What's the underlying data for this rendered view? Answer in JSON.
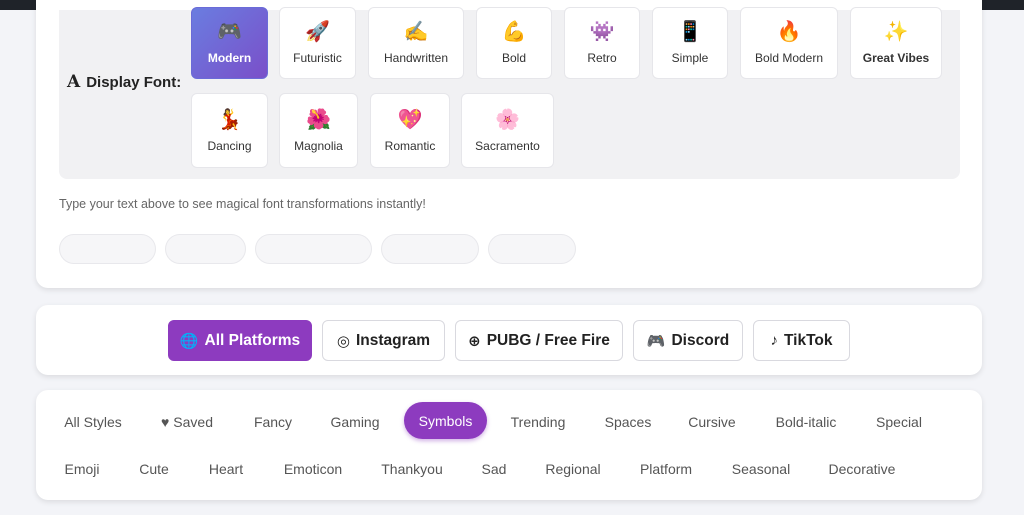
{
  "display_font": {
    "label": "Display Font:",
    "label_icon": "A",
    "fonts": [
      {
        "name": "Modern",
        "emoji": "🎮",
        "active": true
      },
      {
        "name": "Futuristic",
        "emoji": "🚀"
      },
      {
        "name": "Handwritten",
        "emoji": "✍️"
      },
      {
        "name": "Bold",
        "emoji": "💪"
      },
      {
        "name": "Retro",
        "emoji": "👾"
      },
      {
        "name": "Simple",
        "emoji": "📱"
      },
      {
        "name": "Bold Modern",
        "emoji": "🔥"
      },
      {
        "name": "Great Vibes",
        "emoji": "✨"
      },
      {
        "name": "Dancing",
        "emoji": "💃"
      },
      {
        "name": "Magnolia",
        "emoji": "🌺"
      },
      {
        "name": "Romantic",
        "emoji": "💖"
      },
      {
        "name": "Sacramento",
        "emoji": "🌸"
      }
    ],
    "hint": "Type your text above to see magical font transformations instantly!"
  },
  "platforms": [
    {
      "label": "All Platforms",
      "icon": "globe-icon",
      "glyph": "🌐",
      "active": true
    },
    {
      "label": "Instagram",
      "icon": "instagram-icon",
      "glyph": "◎"
    },
    {
      "label": "PUBG / Free Fire",
      "icon": "crosshair-icon",
      "glyph": "⊕"
    },
    {
      "label": "Discord",
      "icon": "discord-icon",
      "glyph": "🎮"
    },
    {
      "label": "TikTok",
      "icon": "tiktok-icon",
      "glyph": "♪"
    }
  ],
  "categories_row1": [
    "All Styles",
    "Saved",
    "Fancy",
    "Gaming",
    "Symbols",
    "Trending",
    "Spaces",
    "Cursive",
    "Bold-italic",
    "Special"
  ],
  "categories_row2": [
    "Emoji",
    "Cute",
    "Heart",
    "Emoticon",
    "Thankyou",
    "Sad",
    "Regional",
    "Platform",
    "Seasonal",
    "Decorative"
  ],
  "active_category": "Symbols",
  "colors": {
    "accent": "#8d3bbf",
    "active_font_gradient_start": "#6a7de0",
    "active_font_gradient_end": "#7a4fc9"
  }
}
